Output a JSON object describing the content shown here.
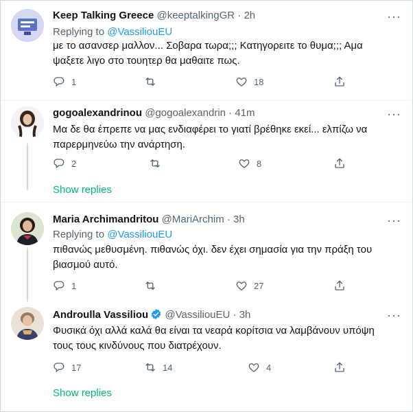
{
  "tweets": [
    {
      "name": "Keep Talking Greece",
      "handle": "@keeptalkingGR",
      "dot": "·",
      "time": "2h",
      "replying_prefix": "Replying to ",
      "replying_to": "@VassiliouEU",
      "text": "με το ασανσερ μαλλον... Σοβαρα τωρα;;; Κατηγορειτε το θυμα;;; Αμα ψαξετε λιγο στο τουητερ θα μαθαιτε πως.",
      "replies": "1",
      "retweets": "",
      "likes": "18"
    },
    {
      "name": "gogoalexandrinou",
      "handle": "@gogoalexandrin",
      "dot": "·",
      "time": "41m",
      "text": "Μα δε θα έπρεπε να μας ενδιαφέρει το γιατί βρέθηκε εκεί... ελπίζω να παρερμηνεύω την ανάρτηση.",
      "replies": "2",
      "retweets": "",
      "likes": "8",
      "show_replies": "Show replies"
    },
    {
      "name": "Maria Archimandritou",
      "handle": "@MariArchim",
      "dot": "·",
      "time": "3h",
      "replying_prefix": "Replying to ",
      "replying_to": "@VassiliouEU",
      "text": "πιθανώς μεθυσμένη. πιθανώς όχι. δεν έχει σημασία για την πράξη του βιασμού αυτό.",
      "replies": "1",
      "retweets": "",
      "likes": "27"
    },
    {
      "name": "Androulla Vassiliou",
      "handle": "@VassiliouEU",
      "dot": "·",
      "time": "3h",
      "text": "Φυσικά όχι αλλά καλά θα είναι τα νεαρά κορίτσια να λαμβάνουν υπόψη τους τους κινδύνους που διατρέχουν.",
      "replies": "17",
      "retweets": "14",
      "likes": "4",
      "show_replies": "Show replies"
    }
  ],
  "more_glyph": "···",
  "icons": [
    "reply-icon",
    "retweet-icon",
    "like-icon",
    "share-icon",
    "verified-icon",
    "more-icon"
  ],
  "colors": {
    "accent": "#1d9bf0",
    "show_replies": "#00ba7c",
    "muted": "#536471",
    "thread_line": "#cfd9de"
  }
}
